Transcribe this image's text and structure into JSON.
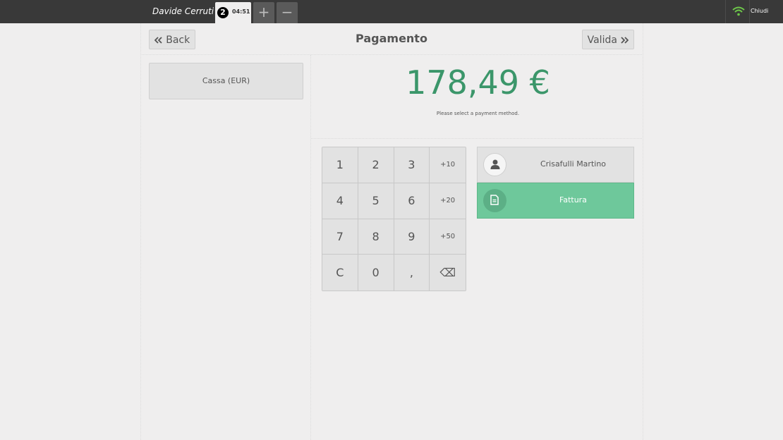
{
  "topbar": {
    "username": "Davide Cerruti",
    "order_number": "2",
    "order_time": "04:51",
    "add_label": "+",
    "remove_label": "−",
    "close_label": "Chiudi"
  },
  "header": {
    "back_label": "Back",
    "title": "Pagamento",
    "validate_label": "Valida"
  },
  "payment_methods": [
    "Cassa (EUR)"
  ],
  "summary": {
    "total": "178,49 €",
    "prompt": "Please select a payment method."
  },
  "numpad": {
    "keys": [
      "1",
      "2",
      "3",
      "+10",
      "4",
      "5",
      "6",
      "+20",
      "7",
      "8",
      "9",
      "+50",
      "C",
      "0",
      ",",
      "⌫"
    ]
  },
  "customer": {
    "name": "Crisafulli Martino"
  },
  "invoice": {
    "label": "Fattura"
  },
  "colors": {
    "accent": "#3b966a",
    "invoice_bg": "#6ec89b",
    "topbar": "#393939",
    "wifi": "#6ec84a"
  },
  "icons": {
    "back": "double-chevron-left-icon",
    "validate": "double-chevron-right-icon",
    "wifi": "wifi-icon",
    "customer": "user-icon",
    "invoice": "document-icon"
  }
}
